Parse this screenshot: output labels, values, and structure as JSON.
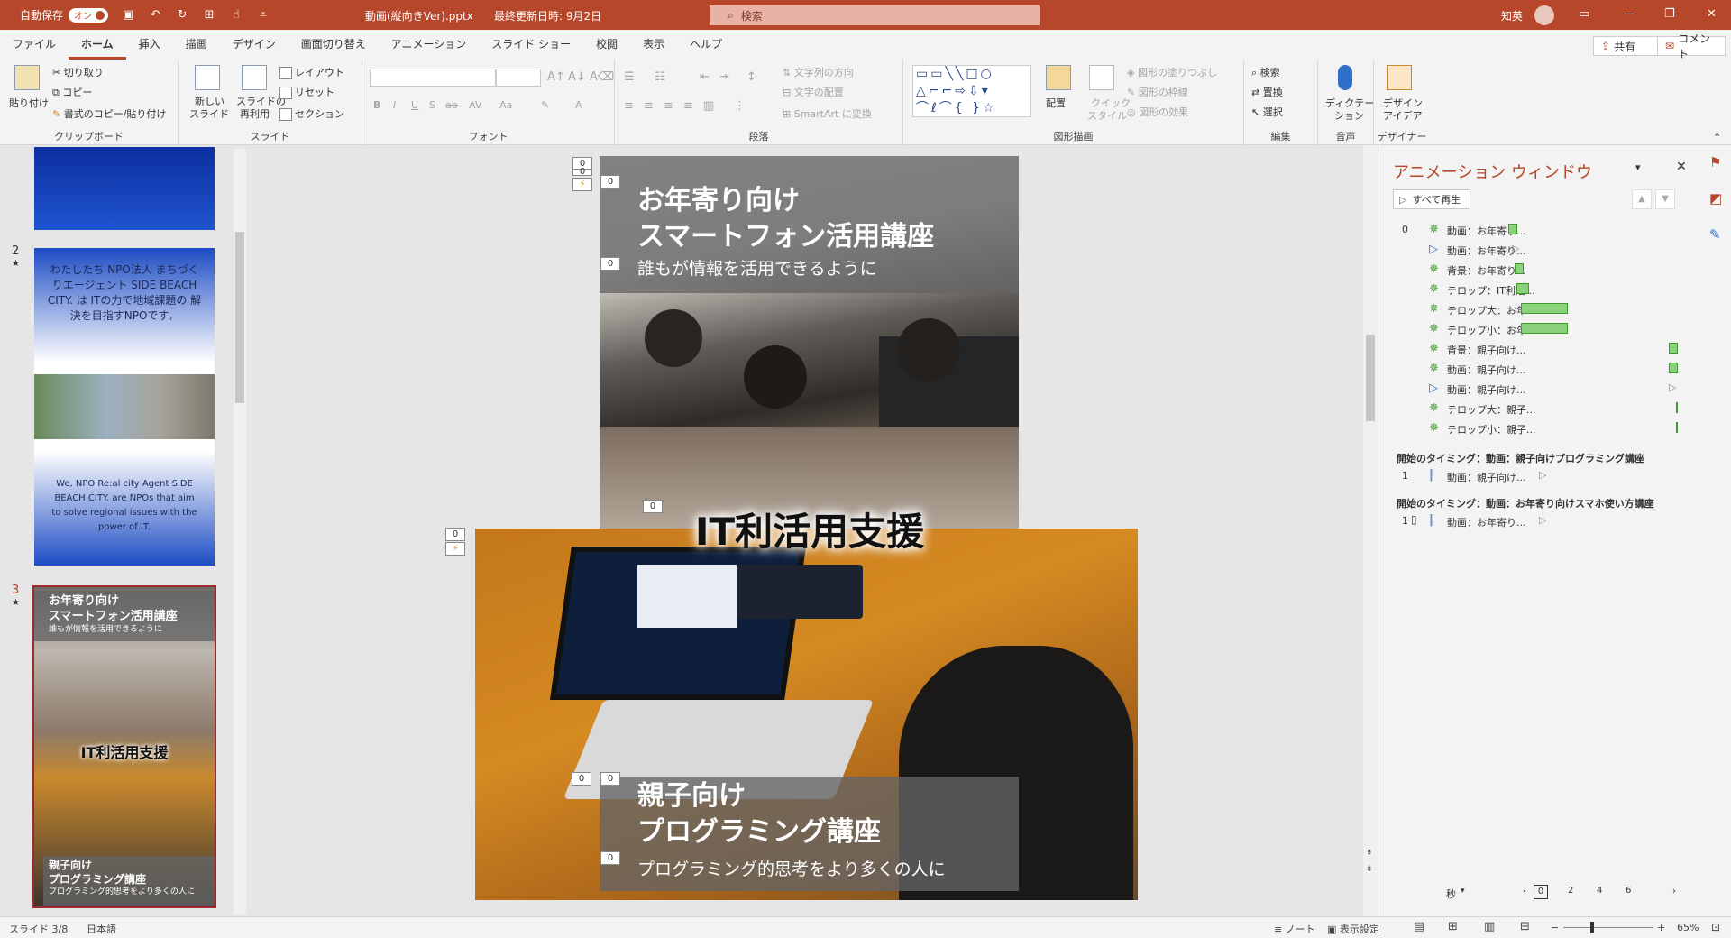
{
  "colors": {
    "accent": "#b7472a",
    "thumb_blue": "#1a47b8",
    "star_green": "#3f9a2e",
    "play_blue": "#2f6fc8",
    "bar_green": "#8bd07a",
    "banner_gray": "#646464"
  },
  "titlebar": {
    "autosave_label": "自動保存",
    "autosave_state": "オン",
    "filename": "動画(縦向きVer).pptx",
    "last_modified": "最終更新日時: 9月2日",
    "search_placeholder": "検索",
    "user_name": "知英"
  },
  "menu": {
    "tabs": [
      "ファイル",
      "ホーム",
      "挿入",
      "描画",
      "デザイン",
      "画面切り替え",
      "アニメーション",
      "スライド ショー",
      "校閲",
      "表示",
      "ヘルプ"
    ],
    "share": "共有",
    "comment": "コメント"
  },
  "ribbon": {
    "clipboard": {
      "paste": "貼り付け",
      "cut": "切り取り",
      "copy": "コピー",
      "format_painter": "書式のコピー/貼り付け",
      "label": "クリップボード"
    },
    "slides": {
      "new_slide_1": "新しい",
      "new_slide_2": "スライド",
      "reuse_1": "スライドの",
      "reuse_2": "再利用",
      "layout": "レイアウト",
      "reset": "リセット",
      "section": "セクション",
      "label": "スライド"
    },
    "font": {
      "label": "フォント"
    },
    "paragraph": {
      "text_direction": "文字列の方向",
      "align_text": "文字の配置",
      "smartart": "SmartArt に変換",
      "label": "段落"
    },
    "drawing": {
      "arrange": "配置",
      "quick_style_1": "クイック",
      "quick_style_2": "スタイル",
      "fill": "図形の塗りつぶし",
      "outline": "図形の枠線",
      "effects": "図形の効果",
      "label": "図形描画"
    },
    "editing": {
      "find": "検索",
      "replace": "置換",
      "select": "選択",
      "label": "編集"
    },
    "voice": {
      "dictate_1": "ディクテー",
      "dictate_2": "ション",
      "label": "音声"
    },
    "designer": {
      "ideas_1": "デザイン",
      "ideas_2": "アイデア",
      "label": "デザイナー"
    }
  },
  "thumbnails": {
    "slide2": {
      "number": "2",
      "star": "★",
      "text_ja": "わたしたち NPO法人 まちづくりエージェント SIDE BEACH CITY. は ITの力で地域課題の 解決を目指すNPOです。",
      "text_en": "We, NPO Re:al city Agent SIDE BEACH CITY. are NPOs that aim to solve regional issues with the power of IT."
    },
    "slide3": {
      "number": "3",
      "star": "★",
      "title1": "お年寄り向け",
      "title2": "スマートフォン活用講座",
      "sub": "誰もが情報を活用できるように",
      "center": "IT利活用支援",
      "bottom1": "親子向け",
      "bottom2": "プログラミング講座",
      "bottom_sub": "プログラミング的思考をより多くの人に"
    }
  },
  "slide": {
    "top_title_1": "お年寄り向け",
    "top_title_2": "スマートフォン活用講座",
    "top_sub": "誰もが情報を活用できるように",
    "center_title": "IT利活用支援",
    "bottom_title_1": "親子向け",
    "bottom_title_2": "プログラミング講座",
    "bottom_sub": "プログラミング的思考をより多くの人に",
    "tag": "0"
  },
  "anim": {
    "title": "アニメーション ウィンドウ",
    "play_all": "すべて再生",
    "group0_index": "0",
    "items": [
      {
        "type": "star",
        "label": "動画：お年寄り..."
      },
      {
        "type": "play",
        "label": "動画：お年寄り..."
      },
      {
        "type": "star",
        "label": "背景：お年寄り..."
      },
      {
        "type": "star",
        "label": "テロップ：IT利活..."
      },
      {
        "type": "star",
        "label": "テロップ大：お年..."
      },
      {
        "type": "star",
        "label": "テロップ小：お年..."
      },
      {
        "type": "star",
        "label": "背景：親子向け..."
      },
      {
        "type": "star",
        "label": "動画：親子向け..."
      },
      {
        "type": "play",
        "label": "動画：親子向け..."
      },
      {
        "type": "star",
        "label": "テロップ大：親子..."
      },
      {
        "type": "star",
        "label": "テロップ小：親子..."
      }
    ],
    "trigger1_label": "開始のタイミング：動画：親子向けプログラミング講座",
    "trigger1_index": "1",
    "trigger1_item": "動画：親子向け...",
    "trigger2_label": "開始のタイミング：動画：お年寄り向けスマホ使い方講座",
    "trigger2_index": "1",
    "trigger2_item": "動画：お年寄り...",
    "seconds": "秒",
    "timeline_ticks": [
      "0",
      "2",
      "4",
      "6"
    ]
  },
  "status": {
    "slide_info": "スライド 3/8",
    "language": "日本語",
    "notes": "ノート",
    "display_settings": "表示設定",
    "zoom": "65%"
  }
}
